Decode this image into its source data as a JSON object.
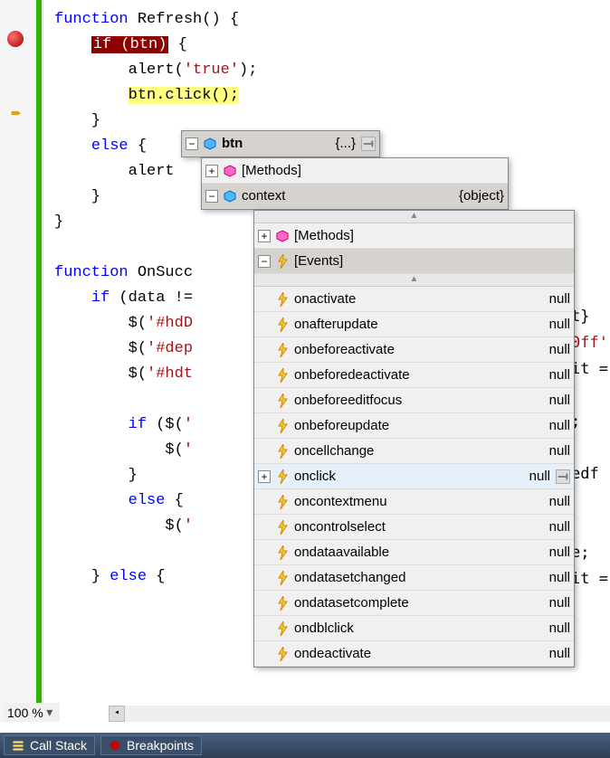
{
  "code": {
    "l1": "function",
    "l1b": " Refresh() {",
    "l2a": "if (btn)",
    "l2b": " {",
    "l3a": "        alert(",
    "l3s": "'true'",
    "l3b": ");",
    "l4a": "btn.click();",
    "l5": "    }",
    "l6a": "    ",
    "l6k": "else",
    "l6b": " {",
    "l7": "        alert",
    "l8": "    }",
    "l9": "}",
    "l11": "function",
    "l11b": " OnSucc",
    "l12a": "    ",
    "l12k": "if",
    "l12b": " (data !=",
    "l13a": "        $(",
    "l13s": "'#hdD",
    "l14a": "        $(",
    "l14s": "'#dep",
    "l15a": "        $(",
    "l15s": "'#hdt",
    "l17a": "        ",
    "l17k": "if",
    "l17b": " ($(",
    "l17s": "'",
    "l18a": "            $(",
    "l18s": "'",
    "l19": "        }",
    "l20a": "        ",
    "l20k": "else",
    "l20b": " {",
    "l21a": "            $(",
    "l21s": "'",
    "l23a": "    } ",
    "l23k": "else",
    "l23b": " {"
  },
  "bgcode": {
    "r1": "t}",
    "r2": "0ff'",
    "r3": "it =",
    "r4": "",
    "r5": ";",
    "r6": "",
    "r7": "edf",
    "r8": "",
    "r9": "",
    "r10": "e;",
    "r11": "it =",
    "r12": "",
    "r13": ""
  },
  "tooltip1": {
    "name": "btn",
    "val": "{...}"
  },
  "tooltip2": {
    "methods": "[Methods]",
    "context": "context",
    "contextVal": "{object}"
  },
  "tooltip3": {
    "methods": "[Methods]",
    "events": "[Events]",
    "rows": [
      {
        "name": "onactivate",
        "val": "null"
      },
      {
        "name": "onafterupdate",
        "val": "null"
      },
      {
        "name": "onbeforeactivate",
        "val": "null"
      },
      {
        "name": "onbeforedeactivate",
        "val": "null"
      },
      {
        "name": "onbeforeeditfocus",
        "val": "null"
      },
      {
        "name": "onbeforeupdate",
        "val": "null"
      },
      {
        "name": "oncellchange",
        "val": "null"
      },
      {
        "name": "onclick",
        "val": "null"
      },
      {
        "name": "oncontextmenu",
        "val": "null"
      },
      {
        "name": "oncontrolselect",
        "val": "null"
      },
      {
        "name": "ondataavailable",
        "val": "null"
      },
      {
        "name": "ondatasetchanged",
        "val": "null"
      },
      {
        "name": "ondatasetcomplete",
        "val": "null"
      },
      {
        "name": "ondblclick",
        "val": "null"
      },
      {
        "name": "ondeactivate",
        "val": "null"
      }
    ]
  },
  "zoom": "100 %",
  "tabs": {
    "callstack": "Call Stack",
    "breakpoints": "Breakpoints"
  }
}
